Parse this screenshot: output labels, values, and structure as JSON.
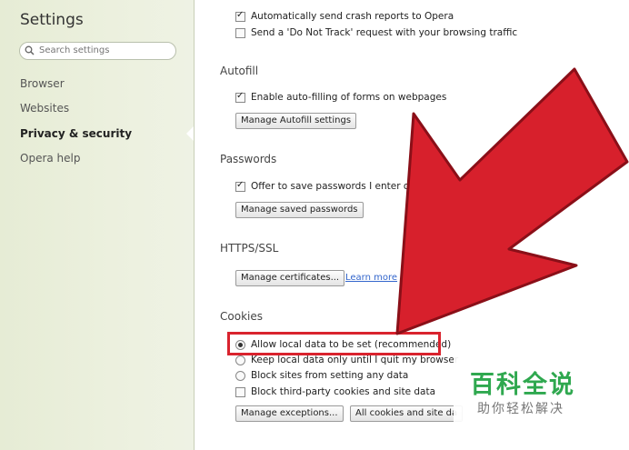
{
  "sidebar": {
    "title": "Settings",
    "search_placeholder": "Search settings",
    "items": [
      {
        "label": "Browser"
      },
      {
        "label": "Websites"
      },
      {
        "label": "Privacy & security"
      },
      {
        "label": "Opera help"
      }
    ],
    "active_item": "Privacy & security"
  },
  "privacy": {
    "crash_reports": {
      "label": "Automatically send crash reports to Opera",
      "checked": true
    },
    "do_not_track": {
      "label": "Send a 'Do Not Track' request with your browsing traffic",
      "checked": false
    }
  },
  "autofill": {
    "title": "Autofill",
    "enable": {
      "label": "Enable auto-filling of forms on webpages",
      "checked": true
    },
    "manage_button": "Manage Autofill settings"
  },
  "passwords": {
    "title": "Passwords",
    "offer_save": {
      "label": "Offer to save passwords I enter on t",
      "checked": true
    },
    "manage_button": "Manage saved passwords"
  },
  "https": {
    "title": "HTTPS/SSL",
    "manage_button": "Manage certificates...",
    "learn_more": "Learn more"
  },
  "cookies": {
    "title": "Cookies",
    "options": [
      {
        "label": "Allow local data to be set (recommended)",
        "selected": true
      },
      {
        "label": "Keep local data only until I quit my browser",
        "selected": false
      },
      {
        "label": "Block sites from setting any data",
        "selected": false
      }
    ],
    "block_third_party": {
      "label": "Block third-party cookies and site data",
      "checked": false
    },
    "manage_exceptions_button": "Manage exceptions...",
    "all_cookies_button": "All cookies and site da"
  },
  "watermark": {
    "brand": "百科全说",
    "tagline": "助你轻松解决"
  },
  "colors": {
    "highlight": "#d9232e",
    "arrow": "#d7202c",
    "watermark_green": "#2fa84f"
  }
}
